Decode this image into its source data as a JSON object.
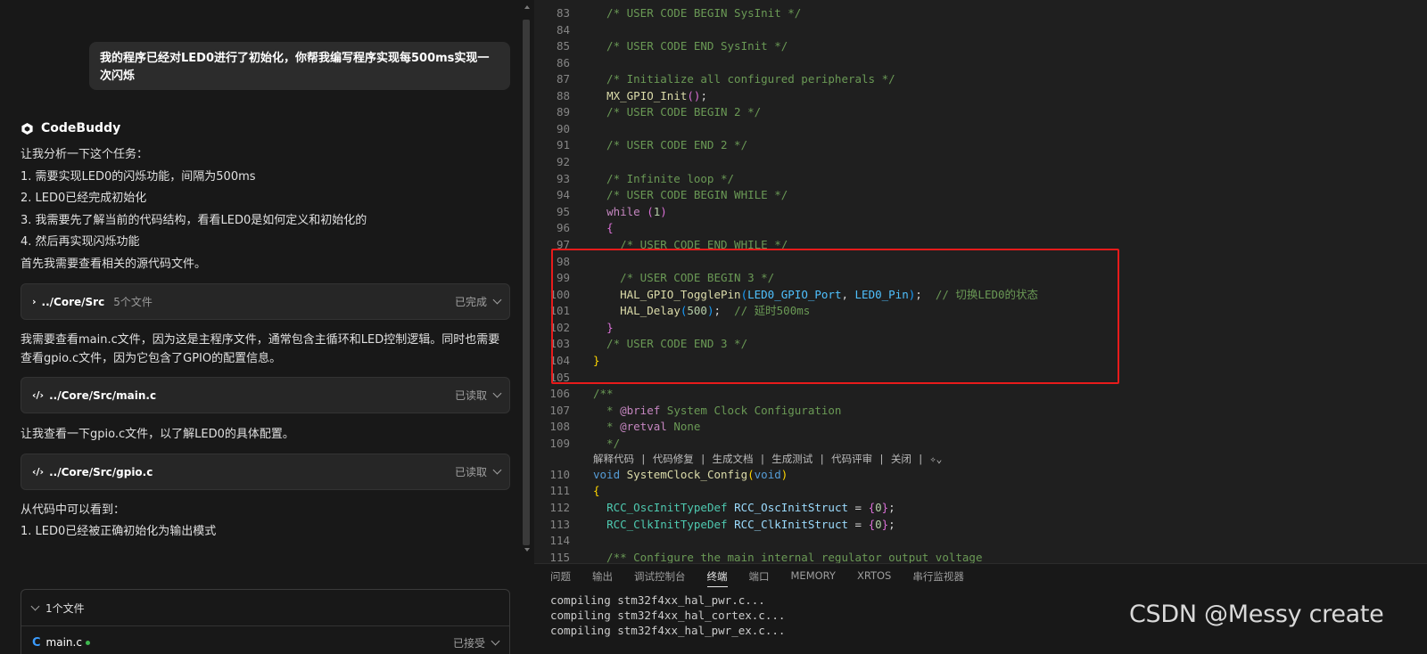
{
  "chat": {
    "user_message": "我的程序已经对LED0进行了初始化，你帮我编写程序实现每500ms实现一次闪烁",
    "bot_name": "CodeBuddy",
    "intro": "让我分析一下这个任务：",
    "steps": [
      "1. 需要实现LED0的闪烁功能，间隔为500ms",
      "2. LED0已经完成初始化",
      "3. 我需要先了解当前的代码结构，看看LED0是如何定义和初始化的",
      "4. 然后再实现闪烁功能"
    ],
    "first_look": "首先我需要查看相关的源代码文件。",
    "card_src": {
      "path": "../Core/Src",
      "meta": "5个文件",
      "status": "已完成"
    },
    "need_read": "我需要查看main.c文件，因为这是主程序文件，通常包含主循环和LED控制逻辑。同时也需要查看gpio.c文件，因为它包含了GPIO的配置信息。",
    "card_main": {
      "path": "../Core/Src/main.c",
      "status": "已读取"
    },
    "look_gpio": "让我查看一下gpio.c文件，以了解LED0的具体配置。",
    "card_gpio": {
      "path": "../Core/Src/gpio.c",
      "status": "已读取"
    },
    "from_code": "从代码中可以看到：",
    "finding_1": "1. LED0已经被正确初始化为输出模式",
    "files_header": "1个文件",
    "file_name": "main.c",
    "file_status": "已接受"
  },
  "editor": {
    "code_lens": "解释代码 | 代码修复 | 生成文档 | 生成测试 | 代码评审 | 关闭 | ",
    "lines": {
      "l83": "  /* USER CODE BEGIN SysInit */",
      "l85": "  /* USER CODE END SysInit */",
      "l87": "  /* Initialize all configured peripherals */",
      "l88_fn": "MX_GPIO_Init",
      "l89": "  /* USER CODE BEGIN 2 */",
      "l91": "  /* USER CODE END 2 */",
      "l93": "  /* Infinite loop */",
      "l94": "  /* USER CODE BEGIN WHILE */",
      "l95_kw": "while",
      "l95_num": "1",
      "l97": "    /* USER CODE END WHILE */",
      "l99": "    /* USER CODE BEGIN 3 */",
      "l100_fn": "HAL_GPIO_TogglePin",
      "l100_a1": "LED0_GPIO_Port",
      "l100_a2": "LED0_Pin",
      "l100_com": "// 切换LED0的状态",
      "l101_fn": "HAL_Delay",
      "l101_num": "500",
      "l101_com": "// 延时500ms",
      "l103": "  /* USER CODE END 3 */",
      "l106": "/**",
      "l107_tag": "@brief",
      "l107_text": " System Clock Configuration",
      "l108_tag": "@retval",
      "l108_text": " None",
      "l109": "  */",
      "l110_kw": "void",
      "l110_fn": "SystemClock_Config",
      "l112_type": "RCC_OscInitTypeDef",
      "l112_var": "RCC_OscInitStruct",
      "l113_type": "RCC_ClkInitTypeDef",
      "l113_var": "RCC_ClkInitStruct",
      "l115": "  /** Configure the main internal regulator output voltage"
    }
  },
  "panel": {
    "tabs": [
      "问题",
      "输出",
      "调试控制台",
      "终端",
      "端口",
      "MEMORY",
      "XRTOS",
      "串行监视器"
    ],
    "active_tab": "终端",
    "terminal": [
      "compiling stm32f4xx_hal_pwr.c...",
      "compiling stm32f4xx_hal_cortex.c...",
      "compiling stm32f4xx_hal_pwr_ex.c..."
    ]
  },
  "watermark": "CSDN @Messy create",
  "colors": {
    "highlight_box": "#e81b1b",
    "comment": "#6a9955",
    "function": "#dcdcaa"
  }
}
